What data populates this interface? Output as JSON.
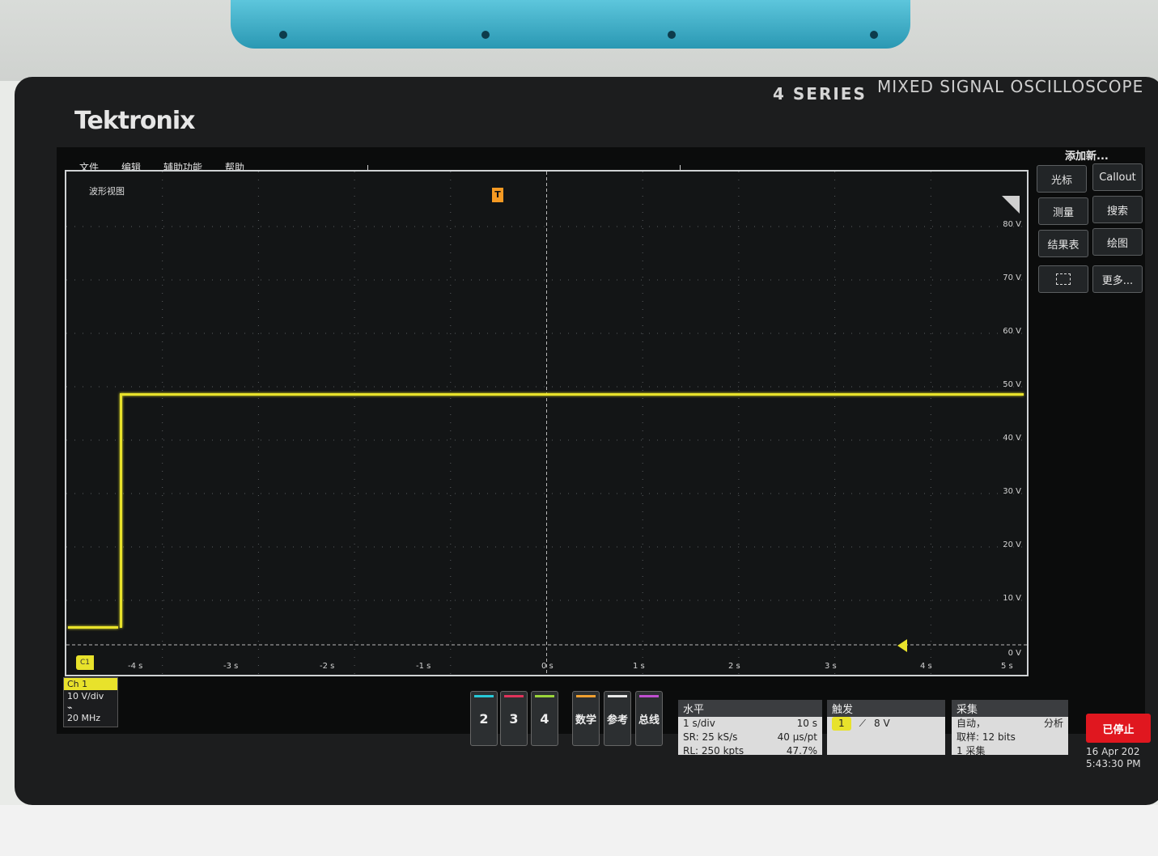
{
  "device": {
    "brand": "Tektronix",
    "series": "4 SERIES",
    "model_text": "MIXED SIGNAL OSCILLOSCOPE"
  },
  "menu": [
    "文件",
    "编辑",
    "辅助功能",
    "帮助"
  ],
  "waveform_view": {
    "title": "波形视图",
    "trigger_marker": "T",
    "y_ticks": [
      "80 V",
      "70 V",
      "60 V",
      "50 V",
      "40 V",
      "30 V",
      "20 V",
      "10 V",
      "0 V"
    ],
    "x_ticks": [
      "-4 s",
      "-3 s",
      "-2 s",
      "-1 s",
      "0 s",
      "1 s",
      "2 s",
      "3 s",
      "4 s",
      "5 s"
    ],
    "channel_marker": "C1",
    "trace_color": "#e8e22b"
  },
  "add_new": {
    "title": "添加新...",
    "buttons": [
      "光标",
      "Callout",
      "测量",
      "搜索",
      "结果表",
      "绘图",
      "更多..."
    ]
  },
  "ch1": {
    "name": "Ch 1",
    "scale": "10 V/div",
    "bandwidth": "20 MHz"
  },
  "channel_buttons": [
    {
      "label": "2",
      "color": "#27c9d8"
    },
    {
      "label": "3",
      "color": "#e0335a"
    },
    {
      "label": "4",
      "color": "#9bd53a"
    },
    {
      "label": "数学",
      "color": "#f0a030"
    },
    {
      "label": "参考",
      "color": "#e8e8e8"
    },
    {
      "label": "总线",
      "color": "#c04fd0"
    }
  ],
  "horizontal": {
    "title": "水平",
    "scale": "1 s/div",
    "duration": "10 s",
    "sample_rate": "SR: 25 kS/s",
    "resolution": "40 µs/pt",
    "record_length": "RL: 250 kpts",
    "position": "47.7%"
  },
  "trigger": {
    "title": "触发",
    "source": "1",
    "level": "8 V"
  },
  "acquisition": {
    "title": "采集",
    "mode": "自动，",
    "analysis": "分析",
    "sampling": "取样: 12 bits",
    "count": "1 采集"
  },
  "status": {
    "run_state": "已停止",
    "date": "16 Apr 202",
    "time": "5:43:30 PM"
  }
}
